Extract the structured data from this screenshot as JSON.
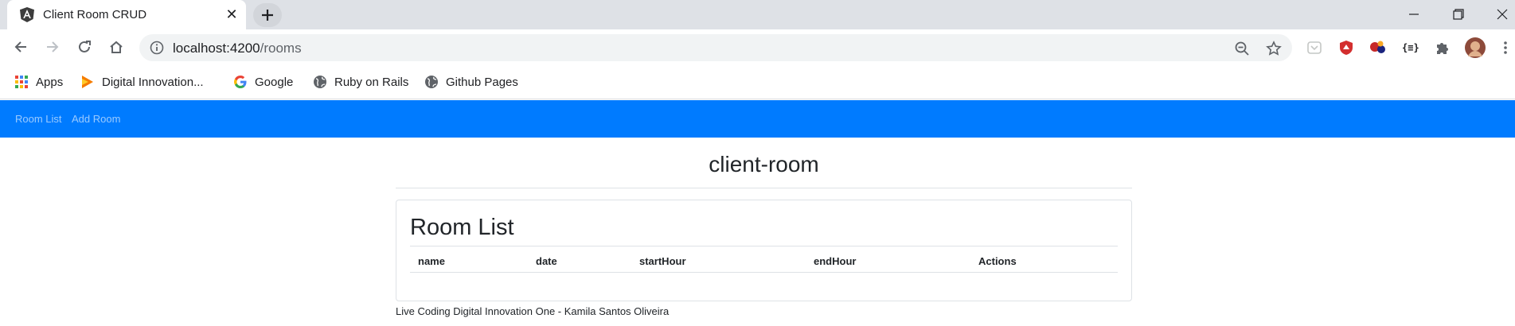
{
  "browser": {
    "tab": {
      "title": "Client Room CRUD"
    },
    "address": {
      "host": "localhost:4200",
      "path": "/rooms"
    },
    "bookmarks": [
      {
        "label": "Apps",
        "icon": "apps-grid-icon"
      },
      {
        "label": "Digital Innovation...",
        "icon": "dio-bookmark-icon"
      },
      {
        "label": "Google",
        "icon": "google-icon"
      },
      {
        "label": "Ruby on Rails",
        "icon": "globe-icon"
      },
      {
        "label": "Github Pages",
        "icon": "globe-icon"
      }
    ]
  },
  "app": {
    "nav": {
      "items": [
        "Room List",
        "Add Room"
      ]
    },
    "title": "client-room",
    "card": {
      "title": "Room List"
    },
    "table": {
      "columns": [
        "name",
        "date",
        "startHour",
        "endHour",
        "Actions"
      ],
      "rows": []
    },
    "footer": "Live Coding Digital Innovation One - Kamila Santos Oliveira"
  },
  "colors": {
    "navbar": "#007bff",
    "tabstrip": "#dee1e6",
    "omnibox": "#f1f3f4"
  }
}
